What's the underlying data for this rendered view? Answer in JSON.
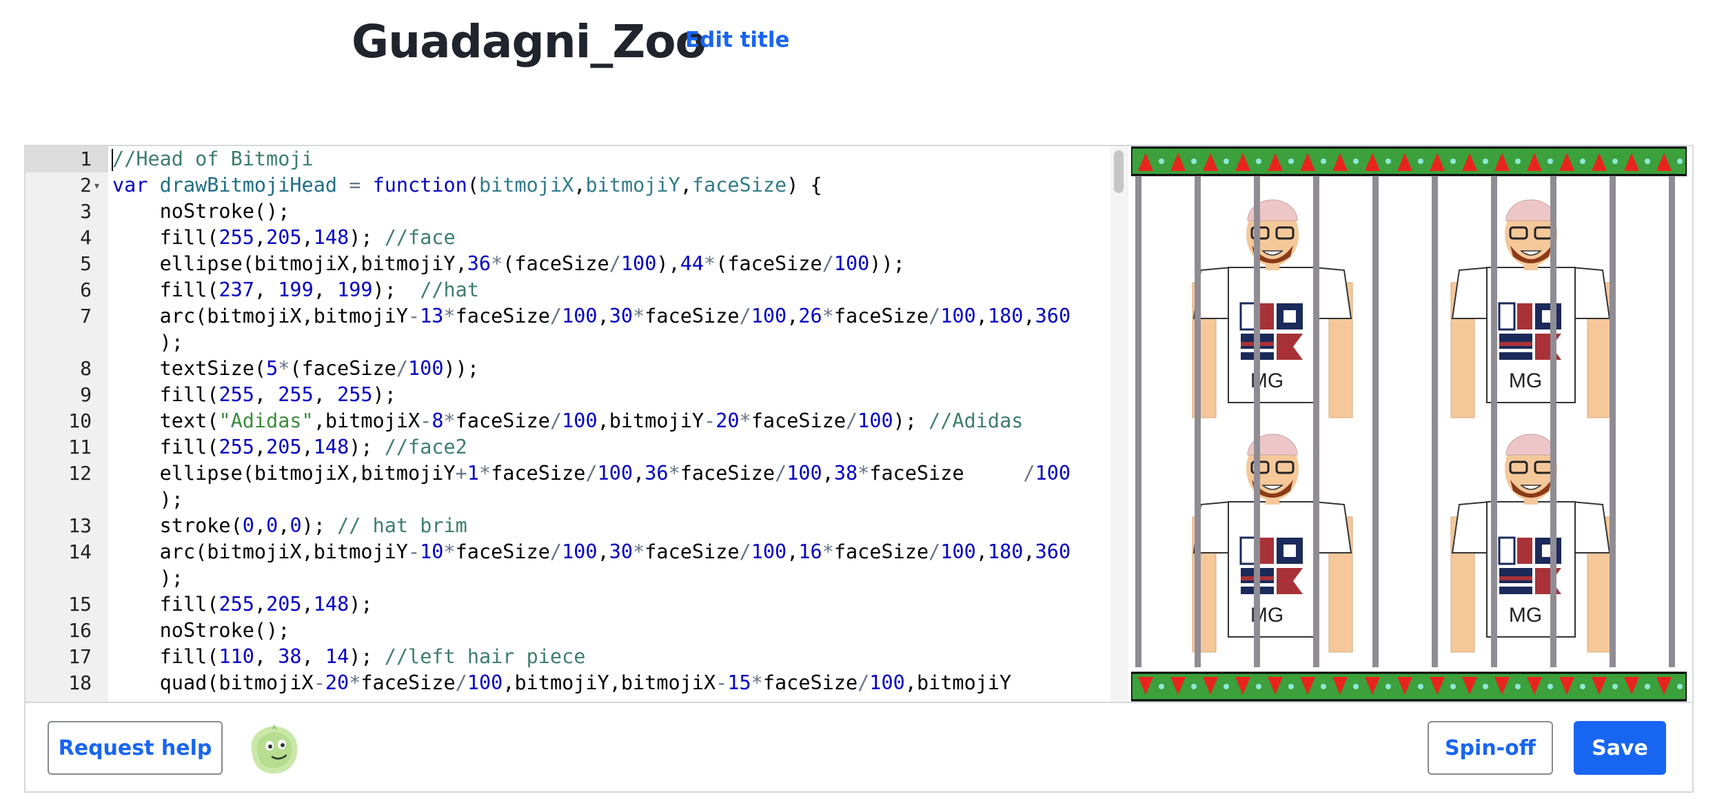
{
  "header": {
    "title": "Guadagni_Zoo",
    "edit_title_label": "Edit title"
  },
  "editor": {
    "active_line": 1,
    "lines": [
      {
        "n": "1",
        "segs": [
          [
            "c",
            "//Head of Bitmoji"
          ]
        ]
      },
      {
        "n": "2",
        "fold": true,
        "segs": [
          [
            "k",
            "var"
          ],
          [
            "p",
            " "
          ],
          [
            "f",
            "drawBitmojiHead"
          ],
          [
            "p",
            " "
          ],
          [
            "o",
            "="
          ],
          [
            "p",
            " "
          ],
          [
            "k",
            "function"
          ],
          [
            "p",
            "("
          ],
          [
            "v",
            "bitmojiX"
          ],
          [
            "p",
            ","
          ],
          [
            "v",
            "bitmojiY"
          ],
          [
            "p",
            ","
          ],
          [
            "v",
            "faceSize"
          ],
          [
            "p",
            ") {"
          ]
        ]
      },
      {
        "n": "3",
        "segs": [
          [
            "p",
            "    noStroke();"
          ]
        ]
      },
      {
        "n": "4",
        "segs": [
          [
            "p",
            "    fill("
          ],
          [
            "n",
            "255"
          ],
          [
            "p",
            ","
          ],
          [
            "n",
            "205"
          ],
          [
            "p",
            ","
          ],
          [
            "n",
            "148"
          ],
          [
            "p",
            "); "
          ],
          [
            "c",
            "//face"
          ]
        ]
      },
      {
        "n": "5",
        "segs": [
          [
            "p",
            "    ellipse(bitmojiX,bitmojiY,"
          ],
          [
            "n",
            "36"
          ],
          [
            "o",
            "*"
          ],
          [
            "p",
            "(faceSize"
          ],
          [
            "o",
            "/"
          ],
          [
            "n",
            "100"
          ],
          [
            "p",
            "),"
          ],
          [
            "n",
            "44"
          ],
          [
            "o",
            "*"
          ],
          [
            "p",
            "(faceSize"
          ],
          [
            "o",
            "/"
          ],
          [
            "n",
            "100"
          ],
          [
            "p",
            "));"
          ]
        ]
      },
      {
        "n": "6",
        "segs": [
          [
            "p",
            "    fill("
          ],
          [
            "n",
            "237"
          ],
          [
            "p",
            ", "
          ],
          [
            "n",
            "199"
          ],
          [
            "p",
            ", "
          ],
          [
            "n",
            "199"
          ],
          [
            "p",
            ");  "
          ],
          [
            "c",
            "//hat"
          ]
        ]
      },
      {
        "n": "7",
        "segs": [
          [
            "p",
            "    arc(bitmojiX,bitmojiY"
          ],
          [
            "o",
            "-"
          ],
          [
            "n",
            "13"
          ],
          [
            "o",
            "*"
          ],
          [
            "p",
            "faceSize"
          ],
          [
            "o",
            "/"
          ],
          [
            "n",
            "100"
          ],
          [
            "p",
            ","
          ],
          [
            "n",
            "30"
          ],
          [
            "o",
            "*"
          ],
          [
            "p",
            "faceSize"
          ],
          [
            "o",
            "/"
          ],
          [
            "n",
            "100"
          ],
          [
            "p",
            ","
          ],
          [
            "n",
            "26"
          ],
          [
            "o",
            "*"
          ],
          [
            "p",
            "faceSize"
          ],
          [
            "o",
            "/"
          ],
          [
            "n",
            "100"
          ],
          [
            "p",
            ","
          ],
          [
            "n",
            "180"
          ],
          [
            "p",
            ","
          ],
          [
            "n",
            "360"
          ]
        ]
      },
      {
        "n": "",
        "segs": [
          [
            "p",
            "    );"
          ]
        ]
      },
      {
        "n": "8",
        "segs": [
          [
            "p",
            "    textSize("
          ],
          [
            "n",
            "5"
          ],
          [
            "o",
            "*"
          ],
          [
            "p",
            "(faceSize"
          ],
          [
            "o",
            "/"
          ],
          [
            "n",
            "100"
          ],
          [
            "p",
            "));"
          ]
        ]
      },
      {
        "n": "9",
        "segs": [
          [
            "p",
            "    fill("
          ],
          [
            "n",
            "255"
          ],
          [
            "p",
            ", "
          ],
          [
            "n",
            "255"
          ],
          [
            "p",
            ", "
          ],
          [
            "n",
            "255"
          ],
          [
            "p",
            ");"
          ]
        ]
      },
      {
        "n": "10",
        "segs": [
          [
            "p",
            "    text("
          ],
          [
            "s",
            "\"Adidas\""
          ],
          [
            "p",
            ",bitmojiX"
          ],
          [
            "o",
            "-"
          ],
          [
            "n",
            "8"
          ],
          [
            "o",
            "*"
          ],
          [
            "p",
            "faceSize"
          ],
          [
            "o",
            "/"
          ],
          [
            "n",
            "100"
          ],
          [
            "p",
            ",bitmojiY"
          ],
          [
            "o",
            "-"
          ],
          [
            "n",
            "20"
          ],
          [
            "o",
            "*"
          ],
          [
            "p",
            "faceSize"
          ],
          [
            "o",
            "/"
          ],
          [
            "n",
            "100"
          ],
          [
            "p",
            "); "
          ],
          [
            "c",
            "//Adidas"
          ]
        ]
      },
      {
        "n": "11",
        "segs": [
          [
            "p",
            "    fill("
          ],
          [
            "n",
            "255"
          ],
          [
            "p",
            ","
          ],
          [
            "n",
            "205"
          ],
          [
            "p",
            ","
          ],
          [
            "n",
            "148"
          ],
          [
            "p",
            "); "
          ],
          [
            "c",
            "//face2"
          ]
        ]
      },
      {
        "n": "12",
        "segs": [
          [
            "p",
            "    ellipse(bitmojiX,bitmojiY"
          ],
          [
            "o",
            "+"
          ],
          [
            "n",
            "1"
          ],
          [
            "o",
            "*"
          ],
          [
            "p",
            "faceSize"
          ],
          [
            "o",
            "/"
          ],
          [
            "n",
            "100"
          ],
          [
            "p",
            ","
          ],
          [
            "n",
            "36"
          ],
          [
            "o",
            "*"
          ],
          [
            "p",
            "faceSize"
          ],
          [
            "o",
            "/"
          ],
          [
            "n",
            "100"
          ],
          [
            "p",
            ","
          ],
          [
            "n",
            "38"
          ],
          [
            "o",
            "*"
          ],
          [
            "p",
            "faceSize     "
          ],
          [
            "o",
            "/"
          ],
          [
            "n",
            "100"
          ]
        ]
      },
      {
        "n": "",
        "segs": [
          [
            "p",
            "    );"
          ]
        ]
      },
      {
        "n": "13",
        "segs": [
          [
            "p",
            "    stroke("
          ],
          [
            "n",
            "0"
          ],
          [
            "p",
            ","
          ],
          [
            "n",
            "0"
          ],
          [
            "p",
            ","
          ],
          [
            "n",
            "0"
          ],
          [
            "p",
            "); "
          ],
          [
            "c",
            "// hat brim"
          ]
        ]
      },
      {
        "n": "14",
        "segs": [
          [
            "p",
            "    arc(bitmojiX,bitmojiY"
          ],
          [
            "o",
            "-"
          ],
          [
            "n",
            "10"
          ],
          [
            "o",
            "*"
          ],
          [
            "p",
            "faceSize"
          ],
          [
            "o",
            "/"
          ],
          [
            "n",
            "100"
          ],
          [
            "p",
            ","
          ],
          [
            "n",
            "30"
          ],
          [
            "o",
            "*"
          ],
          [
            "p",
            "faceSize"
          ],
          [
            "o",
            "/"
          ],
          [
            "n",
            "100"
          ],
          [
            "p",
            ","
          ],
          [
            "n",
            "16"
          ],
          [
            "o",
            "*"
          ],
          [
            "p",
            "faceSize"
          ],
          [
            "o",
            "/"
          ],
          [
            "n",
            "100"
          ],
          [
            "p",
            ","
          ],
          [
            "n",
            "180"
          ],
          [
            "p",
            ","
          ],
          [
            "n",
            "360"
          ]
        ]
      },
      {
        "n": "",
        "segs": [
          [
            "p",
            "    );"
          ]
        ]
      },
      {
        "n": "15",
        "segs": [
          [
            "p",
            "    fill("
          ],
          [
            "n",
            "255"
          ],
          [
            "p",
            ","
          ],
          [
            "n",
            "205"
          ],
          [
            "p",
            ","
          ],
          [
            "n",
            "148"
          ],
          [
            "p",
            ");"
          ]
        ]
      },
      {
        "n": "16",
        "segs": [
          [
            "p",
            "    noStroke();"
          ]
        ]
      },
      {
        "n": "17",
        "segs": [
          [
            "p",
            "    fill("
          ],
          [
            "n",
            "110"
          ],
          [
            "p",
            ", "
          ],
          [
            "n",
            "38"
          ],
          [
            "p",
            ", "
          ],
          [
            "n",
            "14"
          ],
          [
            "p",
            "); "
          ],
          [
            "c",
            "//left hair piece"
          ]
        ]
      },
      {
        "n": "18",
        "segs": [
          [
            "p",
            "    quad(bitmojiX"
          ],
          [
            "o",
            "-"
          ],
          [
            "n",
            "20"
          ],
          [
            "o",
            "*"
          ],
          [
            "p",
            "faceSize"
          ],
          [
            "o",
            "/"
          ],
          [
            "n",
            "100"
          ],
          [
            "p",
            ",bitmojiY,bitmojiX"
          ],
          [
            "o",
            "-"
          ],
          [
            "n",
            "15"
          ],
          [
            "o",
            "*"
          ],
          [
            "p",
            "faceSize"
          ],
          [
            "o",
            "/"
          ],
          [
            "n",
            "100"
          ],
          [
            "p",
            ",bitmojiY"
          ]
        ]
      }
    ],
    "token_colors": {
      "c": "#3d7f68",
      "k": "#0000c4",
      "f": "#1f6e85",
      "v": "#327a8a",
      "n": "#0000c4",
      "o": "#687687",
      "s": "#3c8b3c",
      "p": "#000000"
    }
  },
  "canvas": {
    "shirt_text": "MG",
    "border_color": "#3ca03c",
    "triangle_color": "#e8251c",
    "dot_color": "#8fe8d8",
    "bar_color": "#908c94",
    "skin_color": "#f5c89a",
    "hat_color": "#edc7c7"
  },
  "footer": {
    "request_help_label": "Request help",
    "spinoff_label": "Spin-off",
    "save_label": "Save",
    "accent_color": "#1865f2"
  }
}
